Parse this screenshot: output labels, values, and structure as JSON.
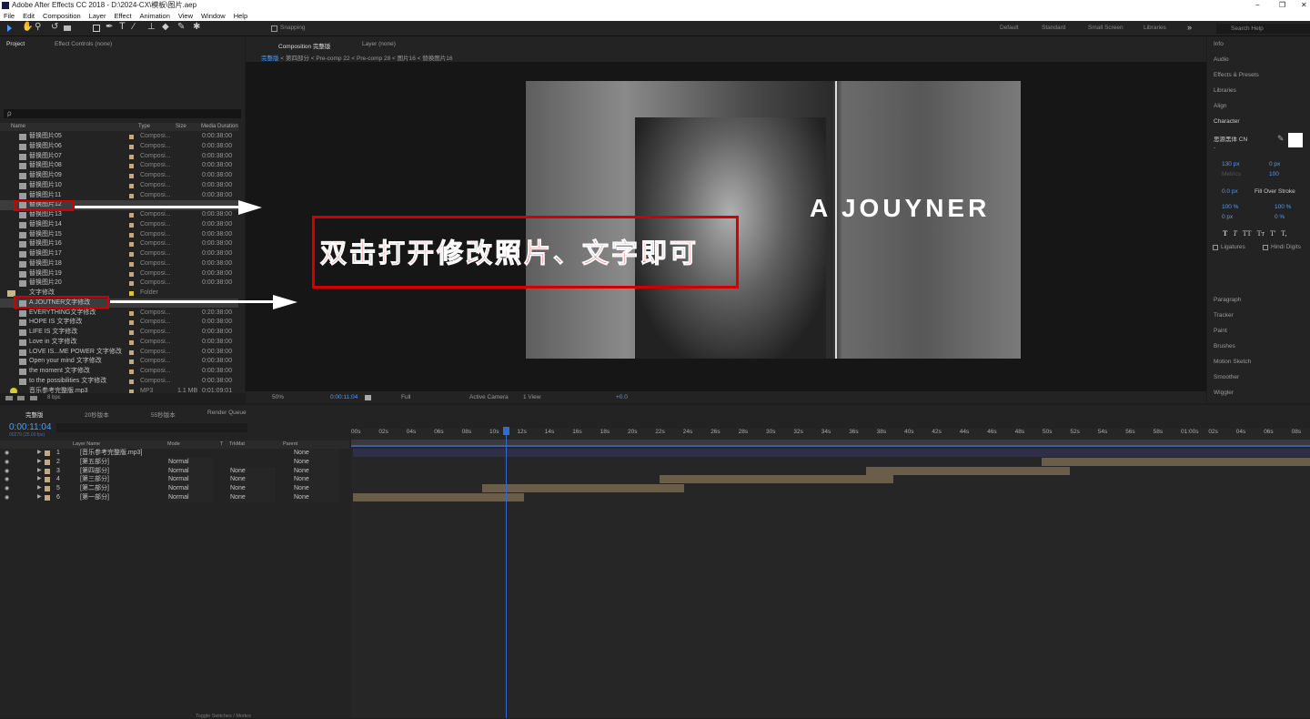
{
  "app": {
    "title": "Adobe After Effects CC 2018 - D:\\2024-CX\\模板\\图片.aep",
    "menus": [
      "File",
      "Edit",
      "Composition",
      "Layer",
      "Effect",
      "Animation",
      "View",
      "Window",
      "Help"
    ],
    "snapping": "Snapping",
    "workspaces": [
      "Default",
      "Standard",
      "Small Screen",
      "Libraries"
    ],
    "search_placeholder": "Search Help",
    "window_controls": [
      "−",
      "❐",
      "✕"
    ]
  },
  "project": {
    "tab": "Project",
    "effects_tab": "Effect Controls (none)",
    "search_symbol": "ρ",
    "columns": [
      "Name",
      "Type",
      "Size",
      "Media Duration"
    ],
    "items": [
      {
        "name": "替换图片05",
        "type": "Composi...",
        "dur": "0:00:38:00"
      },
      {
        "name": "替换图片06",
        "type": "Composi...",
        "dur": "0:00:38:00"
      },
      {
        "name": "替换图片07",
        "type": "Composi...",
        "dur": "0:00:38:00"
      },
      {
        "name": "替换图片08",
        "type": "Composi...",
        "dur": "0:00:38:00"
      },
      {
        "name": "替换图片09",
        "type": "Composi...",
        "dur": "0:00:38:00"
      },
      {
        "name": "替换图片10",
        "type": "Composi...",
        "dur": "0:00:38:00"
      },
      {
        "name": "替换图片11",
        "type": "Composi...",
        "dur": "0:00:38:00"
      },
      {
        "name": "替换图片12",
        "type": "",
        "dur": ""
      },
      {
        "name": "替换图片13",
        "type": "Composi...",
        "dur": "0:00:38:00"
      },
      {
        "name": "替换图片14",
        "type": "Composi...",
        "dur": "0:00:38:00"
      },
      {
        "name": "替换图片15",
        "type": "Composi...",
        "dur": "0:00:38:00"
      },
      {
        "name": "替换图片16",
        "type": "Composi...",
        "dur": "0:00:38:00"
      },
      {
        "name": "替换图片17",
        "type": "Composi...",
        "dur": "0:00:38:00"
      },
      {
        "name": "替换图片18",
        "type": "Composi...",
        "dur": "0:00:38:00"
      },
      {
        "name": "替换图片19",
        "type": "Composi...",
        "dur": "0:00:38:00"
      },
      {
        "name": "替换图片20",
        "type": "Composi...",
        "dur": "0:00:38:00"
      },
      {
        "name": "文字修改",
        "type": "Folder",
        "dur": ""
      },
      {
        "name": "A JOUTNER文字修改",
        "type": "",
        "dur": ""
      },
      {
        "name": "EVERYTHING文字修改",
        "type": "Composi...",
        "dur": "0:20:38:00"
      },
      {
        "name": "HOPE IS 文字修改",
        "type": "Composi...",
        "dur": "0:00:38:00"
      },
      {
        "name": "LIFE IS 文字修改",
        "type": "Composi...",
        "dur": "0:00:38:00"
      },
      {
        "name": "Love in 文字修改",
        "type": "Composi...",
        "dur": "0:00:38:00"
      },
      {
        "name": "LOVE IS...ME POWER 文字修改",
        "type": "Composi...",
        "dur": "0:00:38:00"
      },
      {
        "name": "Open your mind 文字修改",
        "type": "Composi...",
        "dur": "0:00:38:00"
      },
      {
        "name": "the moment 文字修改",
        "type": "Composi...",
        "dur": "0:00:38:00"
      },
      {
        "name": "to the possibilities 文字修改",
        "type": "Composi...",
        "dur": "0:00:38:00"
      },
      {
        "name": "音乐参考完整版.mp3",
        "type": "MP3",
        "size": "1.1 MB",
        "dur": "0:01:09:01"
      }
    ],
    "bpc": "8 bpc"
  },
  "composition": {
    "tab": "Composition 完整版",
    "layer_tab": "Layer (none)",
    "breadcrumbs": [
      "完整版",
      "第四部分",
      "Pre-comp 22",
      "Pre-comp 28",
      "图片16",
      "替换图片16"
    ],
    "overlay_text": "A JOUYNER",
    "annotation": "双击打开修改照片、文字即可",
    "zoom": "50%",
    "timecode": "0:00:11:04",
    "quality": "Full",
    "camera": "Active Camera",
    "view": "1 View",
    "exposure": "+0.0"
  },
  "right_panel": {
    "items_top": [
      "Info",
      "Audio",
      "Effects & Presets",
      "Libraries",
      "Align"
    ],
    "character": "Character",
    "font": "思源黑体 CN",
    "font_style": "-",
    "size": "130 px",
    "kerning_auto": "Metrics",
    "tracking": "100",
    "leading": "0 px",
    "stroke": "0.0 px",
    "stroke_mode": "Fill Over Stroke",
    "vscale": "100 %",
    "hscale": "100 %",
    "baseline": "0 px",
    "tsume": "0 %",
    "ligatures": "Ligatures",
    "hindi": "Hindi Digits",
    "items_bottom": [
      "Paragraph",
      "Tracker",
      "Paint",
      "Brushes",
      "Motion Sketch",
      "Smoother",
      "Wiggler"
    ],
    "styles": [
      "T",
      "T",
      "TT",
      "Tт",
      "T'",
      "T,"
    ]
  },
  "timeline": {
    "tabs": [
      "完整版",
      "20秒版本",
      "55秒版本",
      "Render Queue"
    ],
    "timecode": "0:00:11:04",
    "fps": "00279 (25.00 fps)",
    "cols": [
      "Layer Name",
      "Mode",
      "T",
      "TrkMat",
      "Parent"
    ],
    "layers": [
      {
        "n": "1",
        "name": "[音乐参考完整版.mp3]",
        "mode": "",
        "trk": "",
        "parent": "None"
      },
      {
        "n": "2",
        "name": "[第五部分]",
        "mode": "Normal",
        "trk": "",
        "parent": "None"
      },
      {
        "n": "3",
        "name": "[第四部分]",
        "mode": "Normal",
        "trk": "None",
        "parent": "None"
      },
      {
        "n": "4",
        "name": "[第三部分]",
        "mode": "Normal",
        "trk": "None",
        "parent": "None"
      },
      {
        "n": "5",
        "name": "[第二部分]",
        "mode": "Normal",
        "trk": "None",
        "parent": "None"
      },
      {
        "n": "6",
        "name": "[第一部分]",
        "mode": "Normal",
        "trk": "None",
        "parent": "None"
      }
    ],
    "ruler": [
      "00s",
      "02s",
      "04s",
      "06s",
      "08s",
      "10s",
      "12s",
      "14s",
      "16s",
      "18s",
      "20s",
      "22s",
      "24s",
      "26s",
      "28s",
      "30s",
      "32s",
      "34s",
      "36s",
      "38s",
      "40s",
      "42s",
      "44s",
      "46s",
      "48s",
      "50s",
      "52s",
      "54s",
      "56s",
      "58s",
      "01:00s",
      "02s",
      "04s",
      "06s",
      "08s"
    ],
    "footer": "Toggle Switches / Modes"
  }
}
